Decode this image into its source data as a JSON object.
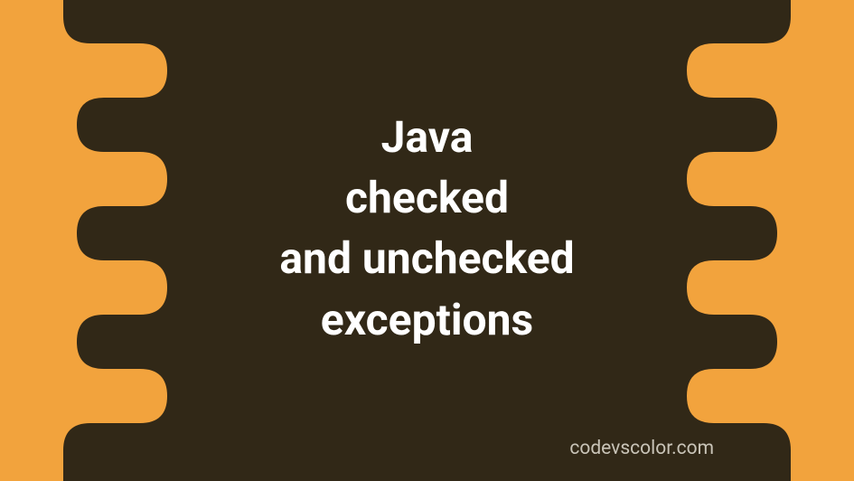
{
  "title_lines": "Java\nchecked\nand unchecked\nexceptions",
  "watermark": "codevscolor.com",
  "colors": {
    "background": "#f2a33d",
    "blob": "#312817",
    "title_text": "#ffffff",
    "watermark_text": "#c9c4b8"
  }
}
